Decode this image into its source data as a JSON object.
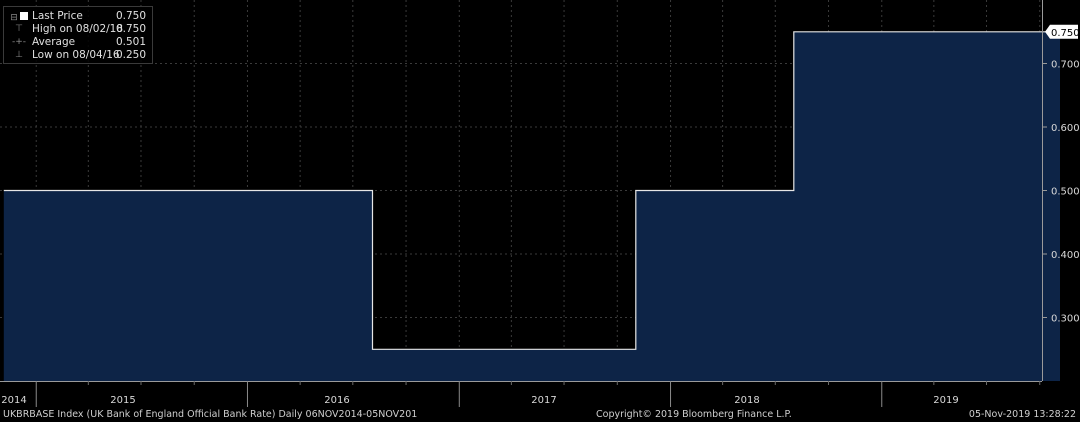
{
  "chart_data": {
    "type": "area",
    "step": true,
    "series": [
      {
        "name": "Last Price",
        "x": [
          "2014-11-06",
          "2016-08-04",
          "2017-11-02",
          "2018-08-02",
          "2019-11-05"
        ],
        "values": [
          0.5,
          0.25,
          0.5,
          0.75,
          0.75
        ]
      }
    ],
    "ylim": [
      0.2,
      0.8
    ],
    "yticks": [
      "0.300",
      "0.400",
      "0.500",
      "0.600",
      "0.700"
    ],
    "last_value_label": "0.750",
    "xtick_labels": [
      "2014",
      "2015",
      "2016",
      "2017",
      "2018",
      "2019"
    ],
    "grid": true,
    "legend_position": "top-left",
    "colors": {
      "fill": "#0d2447",
      "line": "#e6e6e6",
      "grid": "#3a3a3a",
      "background": "#000000"
    }
  },
  "legend": {
    "rows": [
      {
        "label": "Last Price",
        "value": "0.750"
      },
      {
        "label": "High on 08/02/18",
        "value": "0.750"
      },
      {
        "label": "Average",
        "value": "0.501"
      },
      {
        "label": "Low on 08/04/16",
        "value": "0.250"
      }
    ]
  },
  "footer": {
    "description": "UKBRBASE Index (UK Bank of England Official Bank Rate)  Daily 06NOV2014-05NOV201",
    "copyright": "Copyright© 2019 Bloomberg Finance L.P.",
    "timestamp": "05-Nov-2019 13:28:22"
  }
}
